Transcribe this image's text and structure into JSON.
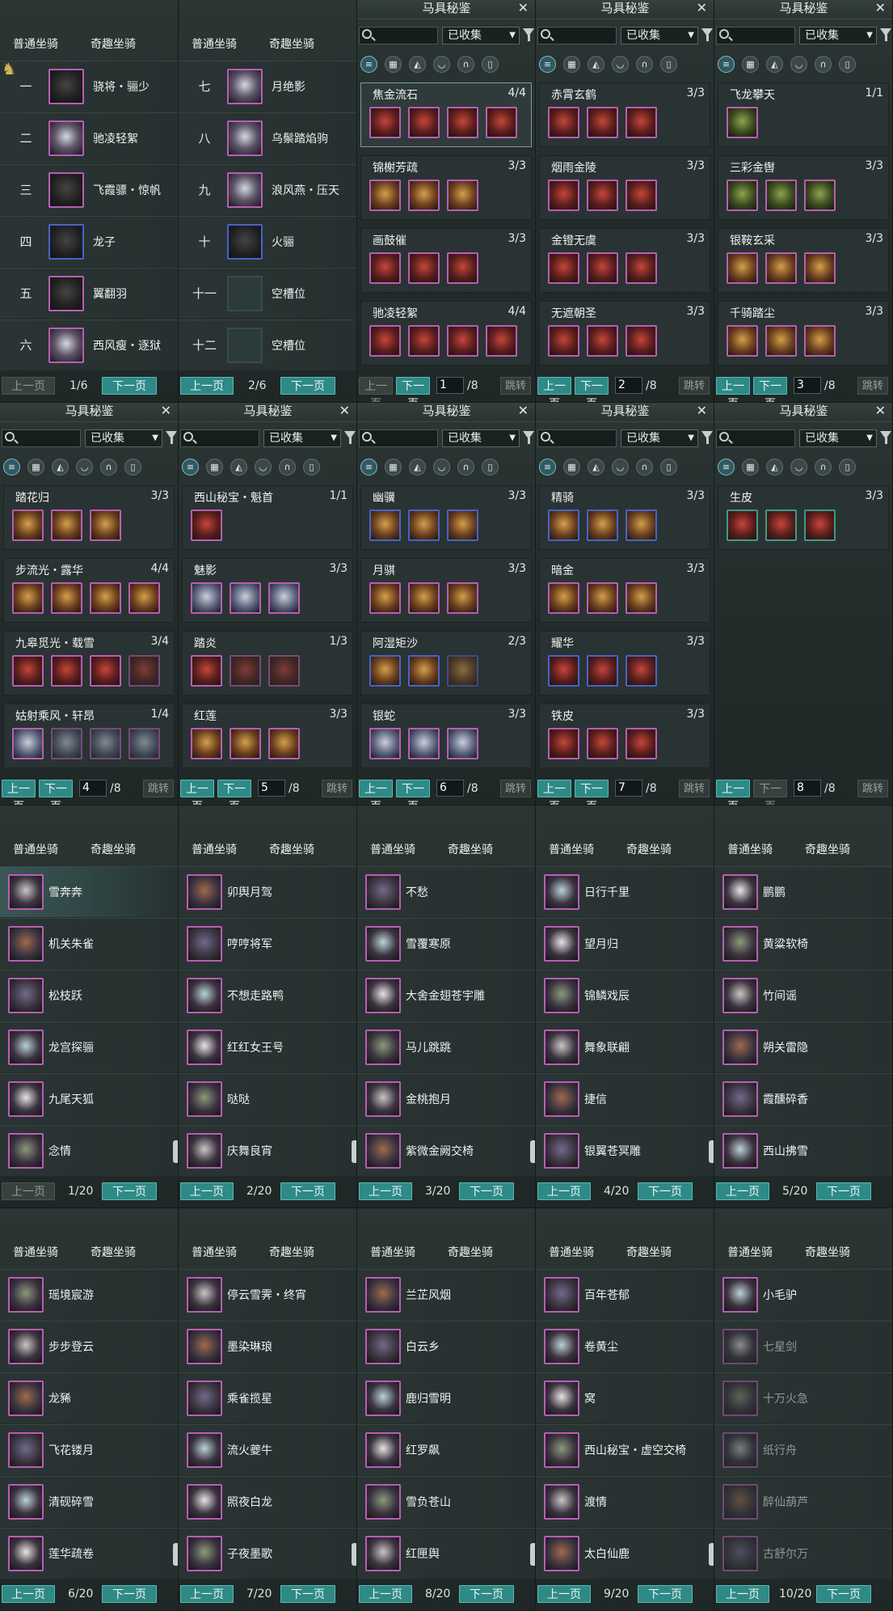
{
  "horses": {
    "tabs": [
      "普通坐骑",
      "奇趣坐骑"
    ],
    "pages": [
      {
        "rows": [
          {
            "num": "一",
            "name": "骁将・骊少"
          },
          {
            "num": "二",
            "name": "驰凌轻絮"
          },
          {
            "num": "三",
            "name": "飞霞骠・惊帆"
          },
          {
            "num": "四",
            "name": "龙子"
          },
          {
            "num": "五",
            "name": "翼翻羽"
          },
          {
            "num": "六",
            "name": "西风瘦・逐狱"
          }
        ],
        "indicator": "1/6"
      },
      {
        "rows": [
          {
            "num": "七",
            "name": "月绝影"
          },
          {
            "num": "八",
            "name": "乌鬃踏焰驹"
          },
          {
            "num": "九",
            "name": "浪风燕・压天"
          },
          {
            "num": "十",
            "name": "火骊"
          },
          {
            "num": "十一",
            "name": "空槽位"
          },
          {
            "num": "十二",
            "name": "空槽位"
          }
        ],
        "indicator": "2/6"
      }
    ]
  },
  "pager": {
    "prev": "上一页",
    "next": "下一页",
    "jump": "跳转",
    "total": "/8"
  },
  "codex": {
    "title": "马具秘鉴",
    "filter": "已收集",
    "pages": [
      {
        "page": "1",
        "cards": [
          {
            "name": "焦金流石",
            "count": "4/4"
          },
          {
            "name": "锦榭芳疏",
            "count": "3/3"
          },
          {
            "name": "画鼓催",
            "count": "3/3"
          },
          {
            "name": "驰凌轻絮",
            "count": "4/4"
          }
        ]
      },
      {
        "page": "2",
        "cards": [
          {
            "name": "赤霄玄鹤",
            "count": "3/3"
          },
          {
            "name": "烟雨金陵",
            "count": "3/3"
          },
          {
            "name": "金镫无虞",
            "count": "3/3"
          },
          {
            "name": "无遮朝圣",
            "count": "3/3"
          }
        ]
      },
      {
        "page": "3",
        "cards": [
          {
            "name": "飞龙攀天",
            "count": "1/1"
          },
          {
            "name": "三彩金辔",
            "count": "3/3"
          },
          {
            "name": "银鞍玄采",
            "count": "3/3"
          },
          {
            "name": "千骑踏尘",
            "count": "3/3"
          }
        ]
      },
      {
        "page": "4",
        "cards": [
          {
            "name": "踏花归",
            "count": "3/3"
          },
          {
            "name": "步流光・露华",
            "count": "4/4"
          },
          {
            "name": "九皋觅光・载雪",
            "count": "3/4"
          },
          {
            "name": "姑射乘风・轩昂",
            "count": "1/4"
          }
        ]
      },
      {
        "page": "5",
        "cards": [
          {
            "name": "西山秘宝・魁首",
            "count": "1/1"
          },
          {
            "name": "魅影",
            "count": "3/3"
          },
          {
            "name": "踏炎",
            "count": "1/3"
          },
          {
            "name": "红莲",
            "count": "3/3"
          }
        ]
      },
      {
        "page": "6",
        "cards": [
          {
            "name": "幽骥",
            "count": "3/3"
          },
          {
            "name": "月骐",
            "count": "3/3"
          },
          {
            "name": "阿湿矩沙",
            "count": "2/3"
          },
          {
            "name": "银蛇",
            "count": "3/3"
          }
        ]
      },
      {
        "page": "7",
        "cards": [
          {
            "name": "精骑",
            "count": "3/3"
          },
          {
            "name": "暗金",
            "count": "3/3"
          },
          {
            "name": "耀华",
            "count": "3/3"
          },
          {
            "name": "铁皮",
            "count": "3/3"
          }
        ]
      },
      {
        "page": "8",
        "cards": [
          {
            "name": "生皮",
            "count": "3/3"
          }
        ]
      }
    ]
  },
  "quirky": {
    "pages": [
      {
        "indicator": "1/20",
        "rows": [
          "雪奔奔",
          "机关朱雀",
          "松枝跃",
          "龙宫探骊",
          "九尾天狐",
          "念情"
        ]
      },
      {
        "indicator": "2/20",
        "rows": [
          "卯舆月驾",
          "哼哼将军",
          "不想走路鸭",
          "红红女王号",
          "哒哒",
          "庆舞良宵"
        ]
      },
      {
        "indicator": "3/20",
        "rows": [
          "不愁",
          "雪覆寒原",
          "大舍金翅苍宇雕",
          "马儿跳跳",
          "金桃抱月",
          "紫微金阙交椅"
        ]
      },
      {
        "indicator": "4/20",
        "rows": [
          "日行千里",
          "望月归",
          "锦鳞戏辰",
          "舞象联翩",
          "捷信",
          "银翼苍冥雕"
        ]
      },
      {
        "indicator": "5/20",
        "rows": [
          "鹏鹏",
          "黄粱软椅",
          "竹间谣",
          "朔关雷隐",
          "霞醺碎香",
          "西山拂雪"
        ]
      },
      {
        "indicator": "6/20",
        "rows": [
          "瑶境宸游",
          "步步登云",
          "龙豨",
          "飞花镂月",
          "清砚碎雪",
          "莲华疏卷"
        ]
      },
      {
        "indicator": "7/20",
        "rows": [
          "停云雪霁・终宵",
          "墨染琳琅",
          "乘雀揽星",
          "流火夔牛",
          "照夜白龙",
          "子夜墨歌"
        ]
      },
      {
        "indicator": "8/20",
        "rows": [
          "兰芷风烟",
          "白云乡",
          "鹿归雪明",
          "红罗飙",
          "雪负苍山",
          "红匣舆"
        ]
      },
      {
        "indicator": "9/20",
        "rows": [
          "百年苍郁",
          "卷黄尘",
          "窝",
          "西山秘宝・虚空交椅",
          "渡情",
          "太白仙鹿"
        ]
      },
      {
        "indicator": "10/20",
        "rows": [
          "小毛驴",
          "七星剑",
          "十万火急",
          "纸行舟",
          "醉仙葫芦",
          "古舒尔万"
        ]
      }
    ]
  }
}
